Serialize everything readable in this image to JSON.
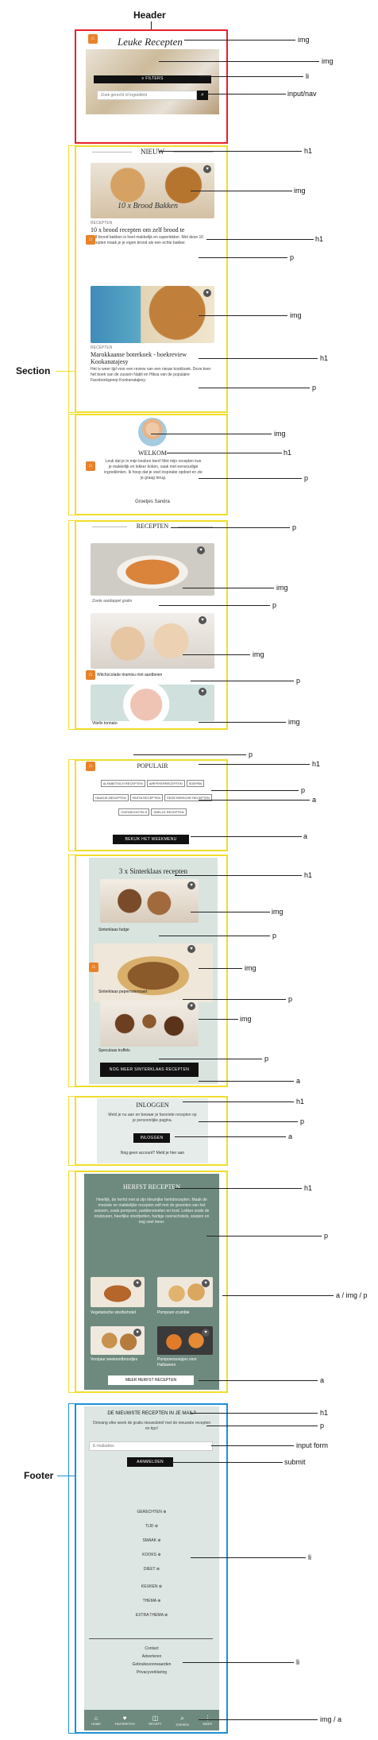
{
  "annotations": {
    "header": "Header",
    "section": "Section",
    "footer": "Footer",
    "img": "img",
    "li": "li",
    "input_nav": "input/nav",
    "h1": "h1",
    "p": "p",
    "a": "a",
    "a_img_p": "a / img / p",
    "input_form": "input form",
    "submit": "submit",
    "img_a": "img / a"
  },
  "header": {
    "logo": "Leuke Recepten",
    "filters_label": "≡ FILTERS",
    "search_placeholder": "Zoek gerecht of ingrediënt"
  },
  "nieuw": {
    "title": "NIEUW",
    "card1": {
      "overlay": "10 x Brood Bakken",
      "category": "RECEPTEN",
      "title": "10 x brood recepten om zelf brood te",
      "desc": "Zelf brood bakken is heel makkelijk en superlekker. Met deze 10 recepten maak je je eigen brood als een echte bakker."
    },
    "card2": {
      "category": "RECEPTEN",
      "title": "Marokkaanse boterkoek - boekreview Kookanatajesy",
      "desc": "Het is weer tijd voor een review van een nieuw kookboek. Deze keer het boek van de zussen Nabil en Hiksa van de populaire Facebookgroep Kookanatajesy."
    }
  },
  "welkom": {
    "title": "WELKOM",
    "text": "Leuk dat je in mijn keuken bent! Met mijn recepten kun je makkelijk en lekker koken, vaak met eenvoudige ingrediënten. Ik hoop dat je veel inspiratie opdoet en zie je graag terug.",
    "sign": "Groetjes Sandra"
  },
  "recepten": {
    "title": "RECEPTEN",
    "item1": "Zoete aardappel gratin",
    "item2": "Witchocolade tiramisu met aardbeien",
    "item3": "Vitello tonnato"
  },
  "populair": {
    "title": "POPULAIR",
    "tags": [
      "ALFABETISCH RECEPTEN",
      "AIRFRYERRECEPTEN",
      "SOEPEN",
      "HAASJE-RECEPTEN",
      "PASTA RECEPTEN",
      "VEGETARISCHE RECEPTEN",
      "OVENSCHOTELS",
      "SNELLE RECEPTEN"
    ],
    "button": "BEKIJK HET WEEKMENU"
  },
  "sinterklaas": {
    "title": "3 x Sinterklaas recepten",
    "item1": "Sinterklaas fudge",
    "item2": "Sinterklaas pepernotentaart",
    "item3": "Speculaas truffels",
    "button": "NOG MEER SINTERKLAAS RECEPTEN"
  },
  "inloggen": {
    "title": "INLOGGEN",
    "text": "Meld je nu aan en bewaar je favoriete recepten op je persoonlijke pagina.",
    "button": "INLOGGEN",
    "register": "Nog geen account? Meld je hier aan"
  },
  "herfst": {
    "title": "HERFST RECEPTEN",
    "text": "Heerlijk, de herfst met al zijn kleurrijke herfstrecepten. Maak de mooiste en makkelijke recepten zelf met de groenten van het seizoen, zoals pompoen, paddenstoelen en kool. Lekker zoals de roodzuren, heerlijke stoofpotten, hartige ovenschotels, soepen en nog veel meer.",
    "item1": "Vegetarische stoofschotel",
    "item2": "Pompoen crumble",
    "item3": "Voorjaar weekendbroodjes",
    "item4": "Pompoensoepjes voor Halloween",
    "button": "MEER HERFST RECEPTEN"
  },
  "footer": {
    "newsletter_title": "DE NIEUWSTE RECEPTEN IN JE MAIL?",
    "newsletter_text": "Ontvang elke week de gratis nieuwsbrief met de nieuwste recepten en tips!",
    "email_placeholder": "E-mailadres",
    "submit": "AANMELDEN",
    "menu": [
      "GERECHTEN",
      "TIJD",
      "SMAAK",
      "KOOKS",
      "DIEET",
      "KEUKEN",
      "THEMA",
      "EXTRA THEMA"
    ],
    "links": [
      "Contact",
      "Adverteren",
      "Gebruiksvoorwaarden",
      "Privacyverklaring"
    ],
    "nav": [
      "HOME",
      "FAVORIETEN",
      "RECEPT",
      "ZOEKEN",
      "MEER"
    ]
  }
}
